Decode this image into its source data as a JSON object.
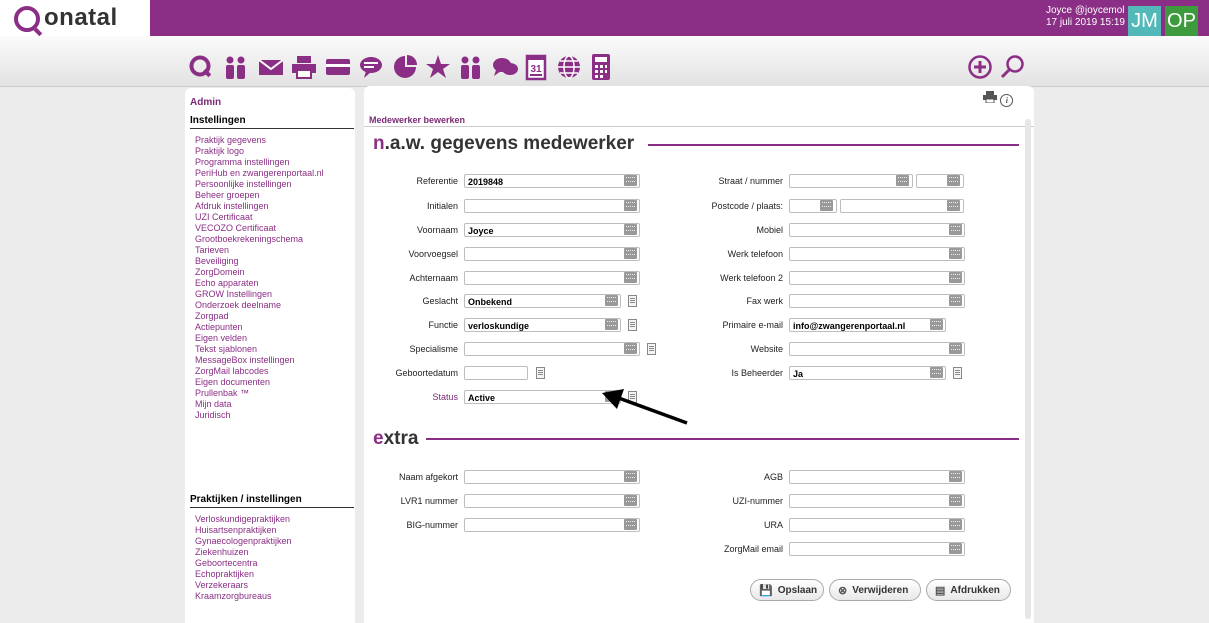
{
  "app": {
    "logo_text": "onatal"
  },
  "user": {
    "name_line": "Joyce @joycemol",
    "datetime": "17 juli 2019 15:19",
    "initials_1": "JM",
    "initials_2": "OP"
  },
  "toolbar": {
    "icons": [
      "onatal-home-icon",
      "clients-icon",
      "mail-icon",
      "print-icon",
      "card-icon",
      "chat-icon",
      "chart-icon",
      "star-icon",
      "team-icon",
      "messages-icon",
      "calendar-icon",
      "globe-icon",
      "calculator-icon"
    ],
    "calendar_day": "31",
    "right_icons": [
      "add-icon",
      "search-icon"
    ]
  },
  "sidebar": {
    "title": "Admin",
    "section1": "Instellingen",
    "items1": [
      "Praktijk gegevens",
      "Praktijk logo",
      "Programma instellingen",
      "PeriHub en zwangerenportaal.nl",
      "Persoonlijke instellingen",
      "Beheer groepen",
      "Afdruk instellingen",
      "UZI Certificaat",
      "VECOZO Certificaat",
      "Grootboekrekeningschema",
      "Tarieven",
      "Beveiliging",
      "ZorgDomein",
      "Echo apparaten",
      "GROW Instellingen",
      "Onderzoek deelname",
      "Zorgpad",
      "Actiepunten",
      "Eigen velden",
      "Tekst sjablonen",
      "MessageBox instellingen",
      "ZorgMail labcodes",
      "Eigen documenten",
      "Prullenbak ™",
      "Mijn data",
      "Juridisch"
    ],
    "section2": "Praktijken / instellingen",
    "items2": [
      "Verloskundigepraktijken",
      "Huisartsenpraktijken",
      "Gynaecologenpraktijken",
      "Ziekenhuizen",
      "Geboortecentra",
      "Echopraktijken",
      "Verzekeraars",
      "Kraamzorgbureaus"
    ]
  },
  "main": {
    "breadcrumb": "Medewerker bewerken",
    "nav_title_accent": "n",
    "nav_title_rest": ".a.w. gegevens medewerker",
    "extra_title_accent": "e",
    "extra_title_rest": "xtra",
    "left_fields": [
      {
        "label": "Referentie",
        "value": "2019848"
      },
      {
        "label": "Initialen",
        "value": ""
      },
      {
        "label": "Voornaam",
        "value": "Joyce"
      },
      {
        "label": "Voorvoegsel",
        "value": ""
      },
      {
        "label": "Achternaam",
        "value": ""
      },
      {
        "label": "Geslacht",
        "value": "Onbekend"
      },
      {
        "label": "Functie",
        "value": "verloskundige"
      },
      {
        "label": "Specialisme",
        "value": ""
      },
      {
        "label": "Geboortedatum",
        "value": ""
      },
      {
        "label": "Status",
        "value": "Active"
      }
    ],
    "right_fields": [
      {
        "label": "Straat / nummer",
        "value": "",
        "value2": ""
      },
      {
        "label": "Postcode / plaats:",
        "value": "",
        "value2": ""
      },
      {
        "label": "Mobiel",
        "value": ""
      },
      {
        "label": "Werk telefoon",
        "value": ""
      },
      {
        "label": "Werk telefoon 2",
        "value": ""
      },
      {
        "label": "Fax werk",
        "value": ""
      },
      {
        "label": "Primaire e-mail",
        "value": "info@zwangerenportaal.nl"
      },
      {
        "label": "Website",
        "value": ""
      },
      {
        "label": "Is Beheerder",
        "value": "Ja"
      }
    ],
    "extra_left": [
      {
        "label": "Naam afgekort",
        "value": ""
      },
      {
        "label": "LVR1 nummer",
        "value": ""
      },
      {
        "label": "BIG-nummer",
        "value": ""
      }
    ],
    "extra_right": [
      {
        "label": "AGB",
        "value": ""
      },
      {
        "label": "UZI-nummer",
        "value": ""
      },
      {
        "label": "URA",
        "value": ""
      },
      {
        "label": "ZorgMail email",
        "value": ""
      }
    ],
    "buttons": {
      "save": "Opslaan",
      "delete": "Verwijderen",
      "print": "Afdrukken"
    },
    "header_icons": [
      "print-icon",
      "info-icon"
    ]
  },
  "colors": {
    "brand": "#8b2e85",
    "avatar_jm": "#53b9b8",
    "avatar_op": "#3d9b3d"
  }
}
